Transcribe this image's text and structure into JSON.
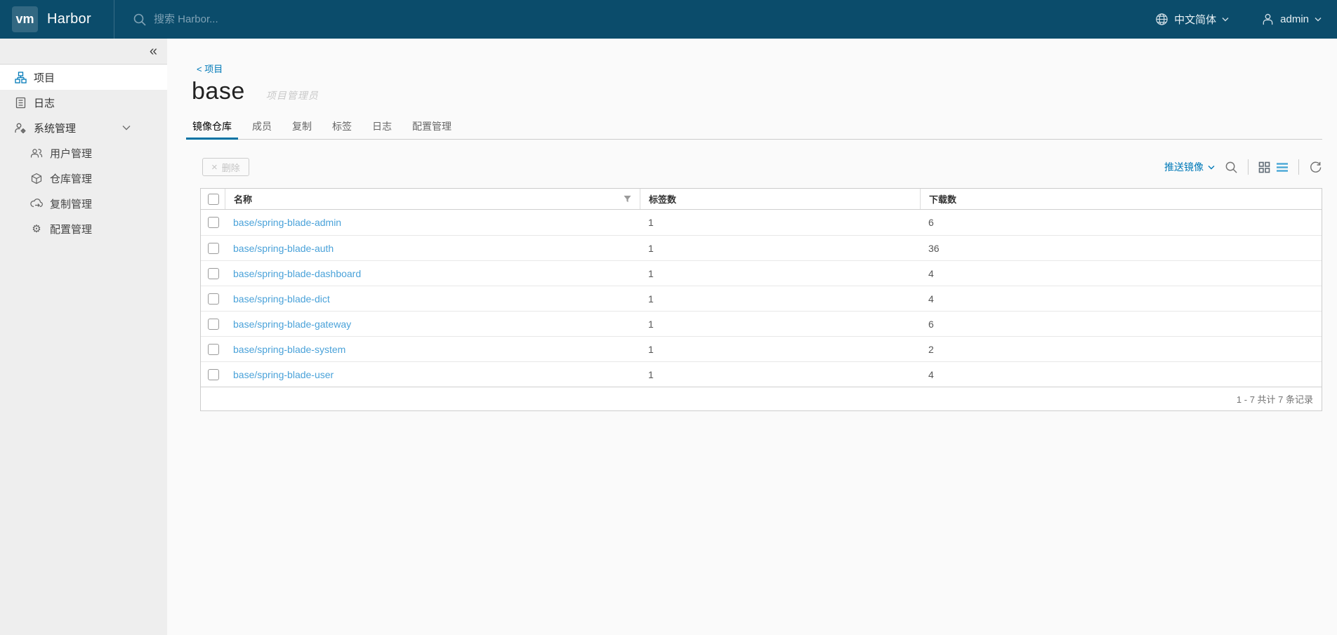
{
  "colors": {
    "navbar_bg": "#0b4c6b",
    "accent_blue": "#0079b8",
    "link_blue": "#4aa2d9",
    "active_tab_underline": "#0072a3",
    "sidebar_bg": "#eeeeee"
  },
  "icons": {
    "collapse": "«",
    "close": "×",
    "gear": "⚙"
  },
  "navbar": {
    "logo": "vm",
    "app_name": "Harbor",
    "search_placeholder": "搜索 Harbor...",
    "language": "中文简体",
    "username": "admin"
  },
  "sidebar": {
    "items": [
      {
        "label": "项目"
      },
      {
        "label": "日志"
      },
      {
        "label": "系统管理"
      }
    ],
    "admin_subitems": [
      {
        "label": "用户管理"
      },
      {
        "label": "仓库管理"
      },
      {
        "label": "复制管理"
      },
      {
        "label": "配置管理"
      }
    ]
  },
  "page": {
    "breadcrumb_arrow": "<",
    "breadcrumb": "项目",
    "title": "base",
    "role": "项目管理员",
    "tabs": [
      "镜像仓库",
      "成员",
      "复制",
      "标签",
      "日志",
      "配置管理"
    ]
  },
  "toolbar": {
    "delete_label": "删除",
    "push_image_label": "推送镜像"
  },
  "table": {
    "headers": {
      "name": "名称",
      "tags": "标签数",
      "downloads": "下载数"
    },
    "rows": [
      {
        "name": "base/spring-blade-admin",
        "tags": "1",
        "downloads": "6"
      },
      {
        "name": "base/spring-blade-auth",
        "tags": "1",
        "downloads": "36"
      },
      {
        "name": "base/spring-blade-dashboard",
        "tags": "1",
        "downloads": "4"
      },
      {
        "name": "base/spring-blade-dict",
        "tags": "1",
        "downloads": "4"
      },
      {
        "name": "base/spring-blade-gateway",
        "tags": "1",
        "downloads": "6"
      },
      {
        "name": "base/spring-blade-system",
        "tags": "1",
        "downloads": "2"
      },
      {
        "name": "base/spring-blade-user",
        "tags": "1",
        "downloads": "4"
      }
    ],
    "summary": "1 - 7 共计 7 条记录"
  }
}
